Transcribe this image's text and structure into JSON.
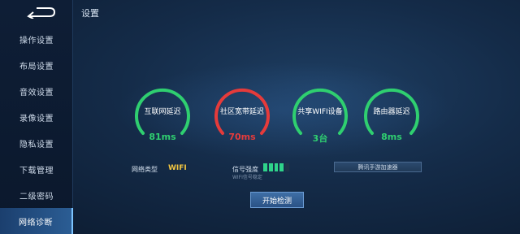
{
  "page": {
    "title": "设置"
  },
  "sidebar": {
    "items": [
      {
        "label": "操作设置"
      },
      {
        "label": "布局设置"
      },
      {
        "label": "音效设置"
      },
      {
        "label": "录像设置"
      },
      {
        "label": "隐私设置"
      },
      {
        "label": "下载管理"
      },
      {
        "label": "二级密码"
      },
      {
        "label": "网络诊断"
      }
    ],
    "active_index": 7
  },
  "gauges": [
    {
      "label": "互联网延迟",
      "value": "81ms",
      "status": "good",
      "color": "#2fcf70"
    },
    {
      "label": "社区宽带延迟",
      "value": "70ms",
      "status": "bad",
      "color": "#e53b3b"
    },
    {
      "label": "共享WIFI设备",
      "value": "3台",
      "status": "good",
      "color": "#2fcf70"
    },
    {
      "label": "路由器延迟",
      "value": "8ms",
      "status": "good",
      "color": "#2fcf70"
    }
  ],
  "network": {
    "type_label": "网络类型",
    "type_value": "WIFI",
    "signal_label": "信号强度",
    "signal_level": 0.8,
    "signal_sub": "WIFI信号稳定"
  },
  "buttons": {
    "accelerator": "腾讯手游加速器",
    "start": "开始检测"
  },
  "colors": {
    "good": "#2fcf70",
    "bad": "#e53b3b",
    "wifi_value": "#f3c640",
    "active_nav": "#2b5d94"
  },
  "icons": {
    "back": "back-arrow-icon"
  }
}
